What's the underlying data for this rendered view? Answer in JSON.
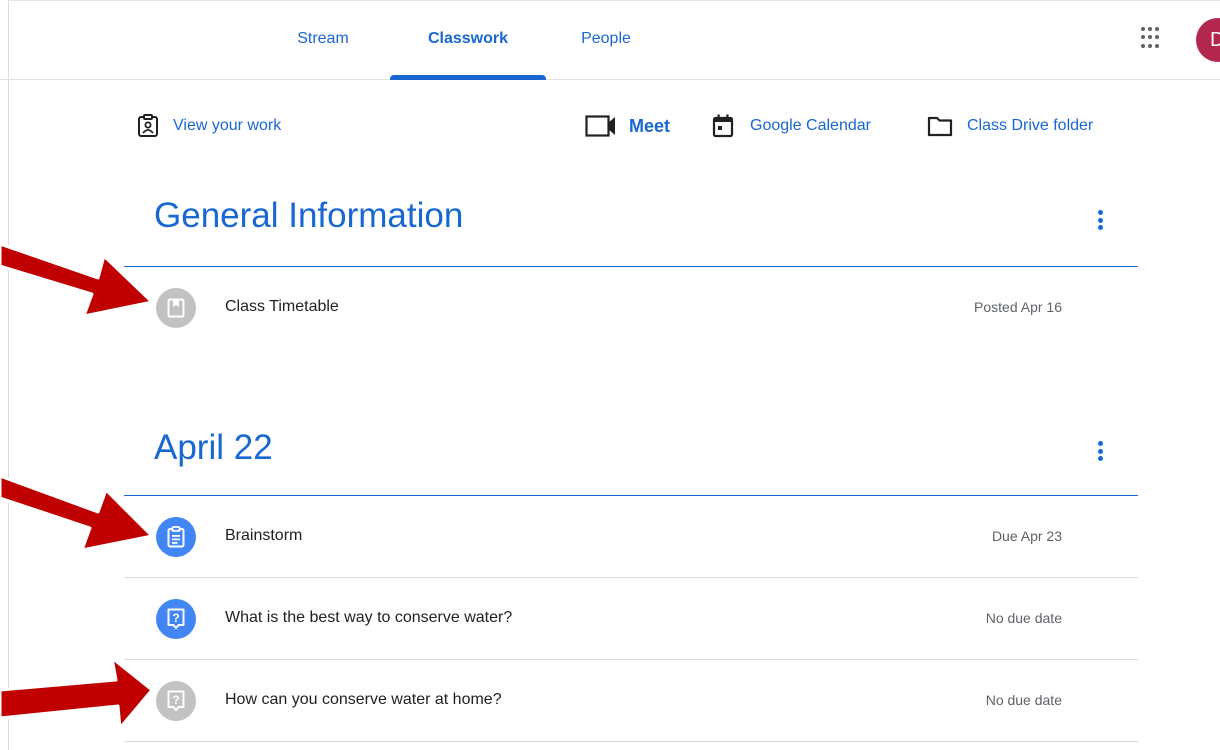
{
  "tabs": [
    {
      "label": "Stream"
    },
    {
      "label": "Classwork",
      "active": true
    },
    {
      "label": "People"
    }
  ],
  "user": {
    "avatar_initial": "D",
    "avatar_color": "#b3264e"
  },
  "actions": {
    "view_work": "View your work",
    "meet": "Meet",
    "calendar": "Google Calendar",
    "drive": "Class Drive folder"
  },
  "topics": [
    {
      "title": "General Information",
      "items": [
        {
          "title": "Class Timetable",
          "meta": "Posted Apr 16",
          "icon": "material-icon",
          "state": "gray"
        }
      ]
    },
    {
      "title": "April 22",
      "items": [
        {
          "title": "Brainstorm",
          "meta": "Due Apr 23",
          "icon": "assignment-icon",
          "state": "blue"
        },
        {
          "title": "What is the best way to conserve water?",
          "meta": "No due date",
          "icon": "question-icon",
          "state": "blue"
        },
        {
          "title": "How can you conserve water at home?",
          "meta": "No due date",
          "icon": "question-icon",
          "state": "gray"
        }
      ]
    }
  ],
  "colors": {
    "accent": "#1967d2",
    "assigned_icon": "#4285f4",
    "done_icon": "#c2c2c2",
    "annotation_arrow": "#c00000"
  }
}
